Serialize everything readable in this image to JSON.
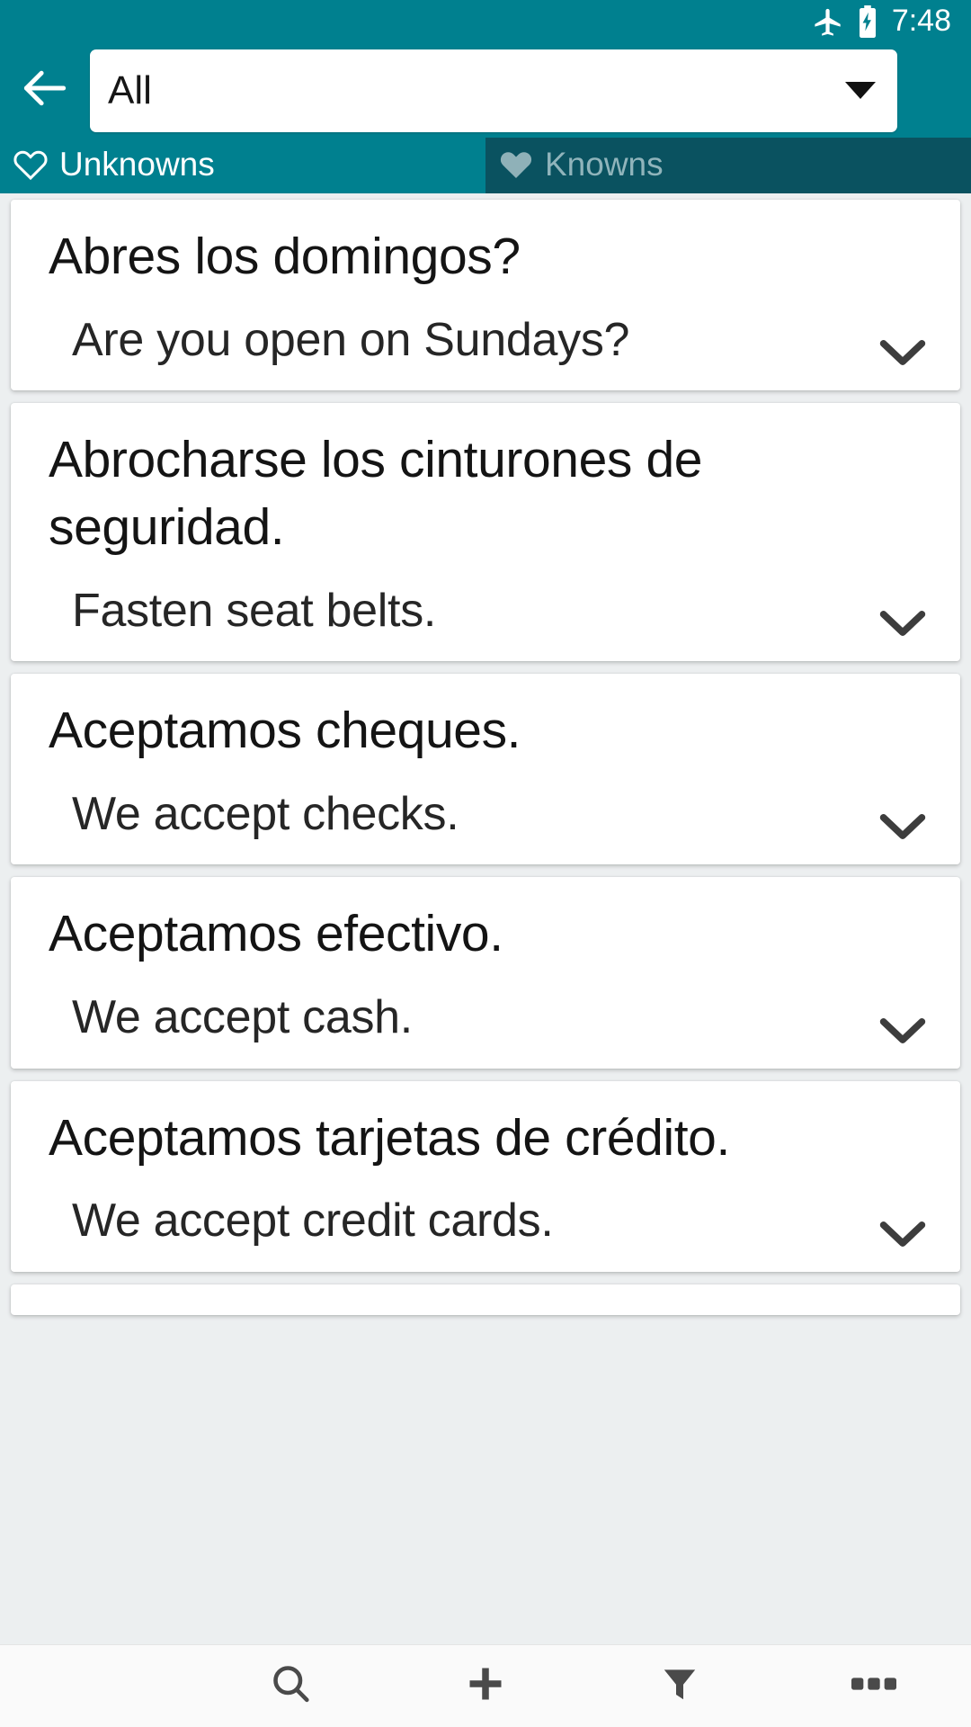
{
  "status_bar": {
    "time": "7:48",
    "icons": [
      "airplane-mode-icon",
      "battery-charging-icon"
    ]
  },
  "app_bar": {
    "back_icon": "arrow-left-icon",
    "spinner_value": "All",
    "spinner_caret_icon": "caret-down-icon"
  },
  "tabs": [
    {
      "label": "Unknowns",
      "icon": "heart-outline-icon",
      "active": true
    },
    {
      "label": "Knowns",
      "icon": "heart-filled-icon",
      "active": false
    }
  ],
  "cards": [
    {
      "term": "Abres los domingos?",
      "translation": "Are you open on Sundays?",
      "chevron_icon": "chevron-down-icon"
    },
    {
      "term": "Abrocharse los cinturones de seguridad.",
      "translation": "Fasten seat belts.",
      "chevron_icon": "chevron-down-icon"
    },
    {
      "term": "Aceptamos cheques.",
      "translation": "We accept checks.",
      "chevron_icon": "chevron-down-icon"
    },
    {
      "term": "Aceptamos efectivo.",
      "translation": "We accept cash.",
      "chevron_icon": "chevron-down-icon"
    },
    {
      "term": "Aceptamos tarjetas de crédito.",
      "translation": "We accept credit cards.",
      "chevron_icon": "chevron-down-icon"
    }
  ],
  "bottom_toolbar": [
    {
      "name": "search",
      "icon": "search-icon"
    },
    {
      "name": "add",
      "icon": "plus-icon"
    },
    {
      "name": "filter",
      "icon": "funnel-icon"
    },
    {
      "name": "more",
      "icon": "overflow-dots-icon"
    }
  ],
  "colors": {
    "primary": "#00808f",
    "primary_dark": "#0a5260",
    "list_background": "#eceff0",
    "card_background": "#ffffff",
    "toolbar_background": "#fafafa",
    "icon_gray": "#4a4a4a",
    "inactive_tab_text": "#90b4bb"
  }
}
